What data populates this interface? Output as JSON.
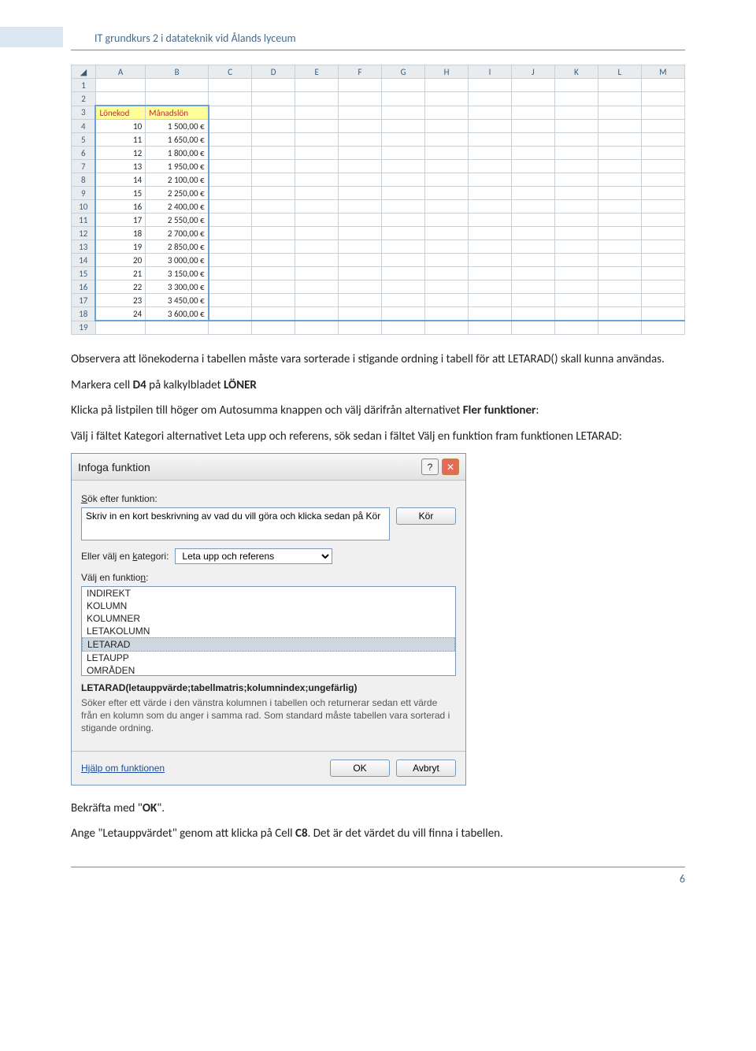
{
  "header": {
    "course": "IT grundkurs 2 i datateknik vid Ålands lyceum"
  },
  "sheet": {
    "columns": [
      "A",
      "B",
      "C",
      "D",
      "E",
      "F",
      "G",
      "H",
      "I",
      "J",
      "K",
      "L",
      "M"
    ],
    "rows": [
      1,
      2,
      3,
      4,
      5,
      6,
      7,
      8,
      9,
      10,
      11,
      12,
      13,
      14,
      15,
      16,
      17,
      18,
      19
    ],
    "headers": {
      "a3": "Lönekod",
      "b3": "Månadslön"
    },
    "data": [
      {
        "r": 4,
        "code": "10",
        "salary": "1 500,00 €"
      },
      {
        "r": 5,
        "code": "11",
        "salary": "1 650,00 €"
      },
      {
        "r": 6,
        "code": "12",
        "salary": "1 800,00 €"
      },
      {
        "r": 7,
        "code": "13",
        "salary": "1 950,00 €"
      },
      {
        "r": 8,
        "code": "14",
        "salary": "2 100,00 €"
      },
      {
        "r": 9,
        "code": "15",
        "salary": "2 250,00 €"
      },
      {
        "r": 10,
        "code": "16",
        "salary": "2 400,00 €"
      },
      {
        "r": 11,
        "code": "17",
        "salary": "2 550,00 €"
      },
      {
        "r": 12,
        "code": "18",
        "salary": "2 700,00 €"
      },
      {
        "r": 13,
        "code": "19",
        "salary": "2 850,00 €"
      },
      {
        "r": 14,
        "code": "20",
        "salary": "3 000,00 €"
      },
      {
        "r": 15,
        "code": "21",
        "salary": "3 150,00 €"
      },
      {
        "r": 16,
        "code": "22",
        "salary": "3 300,00 €"
      },
      {
        "r": 17,
        "code": "23",
        "salary": "3 450,00 €"
      },
      {
        "r": 18,
        "code": "24",
        "salary": "3 600,00 €"
      }
    ]
  },
  "text": {
    "p1": "Observera att lönekoderna i tabellen måste vara sorterade i stigande ordning i tabell för att LETARAD() skall kunna användas.",
    "p2a": "Markera cell ",
    "p2b": "D4",
    "p2c": " på kalkylbladet ",
    "p2d": "LÖNER",
    "p3a": "Klicka på listpilen till höger om Autosumma knappen och välj därifrån alternativet ",
    "p3b": "Fler funktioner",
    "p3c": ":",
    "p4": "Välj i fältet Kategori alternativet Leta upp och referens, sök sedan i fältet Välj en funktion fram funktionen LETARAD:",
    "p5a": "Bekräfta med \"",
    "p5b": "OK",
    "p5c": "\".",
    "p6a": "Ange \"Letauppvärdet\" genom att klicka på Cell ",
    "p6b": "C8",
    "p6c": ". Det är det värdet du vill finna i tabellen."
  },
  "dialog": {
    "title": "Infoga funktion",
    "search_label": "Sök efter funktion:",
    "search_value": "Skriv in en kort beskrivning av vad du vill göra och klicka sedan på Kör",
    "run_btn": "Kör",
    "category_label": "Eller välj en kategori:",
    "category_value": "Leta upp och referens",
    "select_fn_label": "Välj en funktion:",
    "functions": [
      "INDIREKT",
      "KOLUMN",
      "KOLUMNER",
      "LETAKOLUMN",
      "LETARAD",
      "LETAUPP",
      "OMRÅDEN"
    ],
    "selected_fn": "LETARAD",
    "syntax": "LETARAD(letauppvärde;tabellmatris;kolumnindex;ungefärlig)",
    "description": "Söker efter ett värde i den vänstra kolumnen i tabellen och returnerar sedan ett värde från en kolumn som du anger i samma rad. Som standard måste tabellen vara sorterad i stigande ordning.",
    "help_link": "Hjälp om funktionen",
    "ok_btn": "OK",
    "cancel_btn": "Avbryt"
  },
  "page_number": "6"
}
